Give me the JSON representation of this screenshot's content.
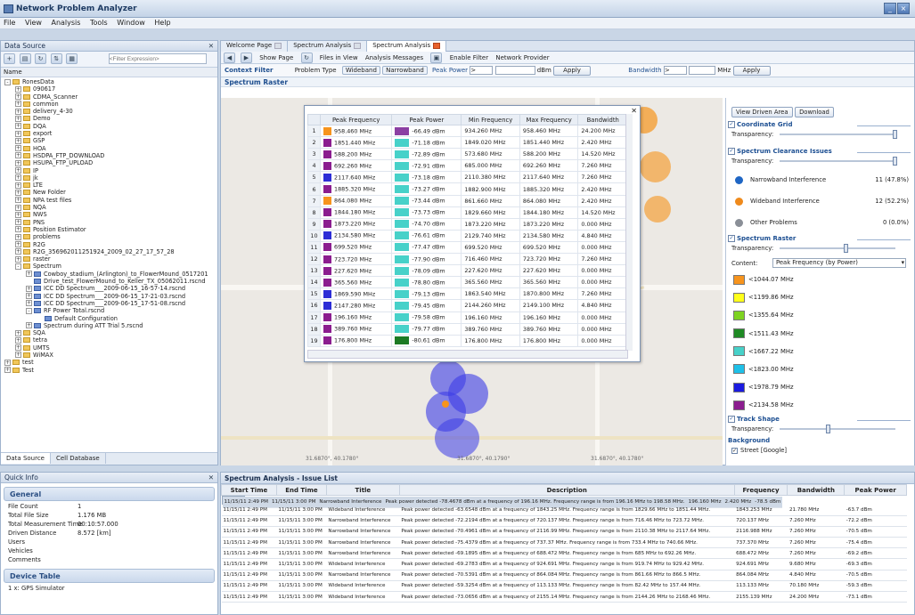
{
  "app": {
    "title": "Network Problem Analyzer"
  },
  "menu": [
    "File",
    "View",
    "Analysis",
    "Tools",
    "Window",
    "Help"
  ],
  "left_panel": {
    "title": "Data Source",
    "filter_placeholder": "<Filter Expression>",
    "tree_header": "Name",
    "tree": [
      {
        "d": 0,
        "t": "RonesData",
        "k": "f",
        "x": "-"
      },
      {
        "d": 1,
        "t": "090617",
        "k": "f",
        "x": "+"
      },
      {
        "d": 1,
        "t": "CDMA_Scanner",
        "k": "f",
        "x": "+"
      },
      {
        "d": 1,
        "t": "common",
        "k": "f",
        "x": "+"
      },
      {
        "d": 1,
        "t": "delivery_4-30",
        "k": "f",
        "x": "+"
      },
      {
        "d": 1,
        "t": "Demo",
        "k": "f",
        "x": "+"
      },
      {
        "d": 1,
        "t": "DQA",
        "k": "f",
        "x": "+"
      },
      {
        "d": 1,
        "t": "export",
        "k": "f",
        "x": "+"
      },
      {
        "d": 1,
        "t": "GSP",
        "k": "f",
        "x": "+"
      },
      {
        "d": 1,
        "t": "HOA",
        "k": "f",
        "x": "+"
      },
      {
        "d": 1,
        "t": "HSDPA_FTP_DOWNLOAD",
        "k": "f",
        "x": "+"
      },
      {
        "d": 1,
        "t": "HSUPA_FTP_UPLOAD",
        "k": "f",
        "x": "+"
      },
      {
        "d": 1,
        "t": "IP",
        "k": "f",
        "x": "+"
      },
      {
        "d": 1,
        "t": "jk",
        "k": "f",
        "x": "+"
      },
      {
        "d": 1,
        "t": "LTE",
        "k": "f",
        "x": "+"
      },
      {
        "d": 1,
        "t": "New Folder",
        "k": "f",
        "x": "+"
      },
      {
        "d": 1,
        "t": "NPA test files",
        "k": "f",
        "x": "+"
      },
      {
        "d": 1,
        "t": "NQA",
        "k": "f",
        "x": "+"
      },
      {
        "d": 1,
        "t": "NWS",
        "k": "f",
        "x": "+"
      },
      {
        "d": 1,
        "t": "PNS",
        "k": "f",
        "x": "+"
      },
      {
        "d": 1,
        "t": "Position Estimator",
        "k": "f",
        "x": "+"
      },
      {
        "d": 1,
        "t": "problems",
        "k": "f",
        "x": "+"
      },
      {
        "d": 1,
        "t": "R2G",
        "k": "f",
        "x": "+"
      },
      {
        "d": 1,
        "t": "R2G_356962011251924_2009_02_27_17_57_28",
        "k": "f",
        "x": "+"
      },
      {
        "d": 1,
        "t": "raster",
        "k": "f",
        "x": "+"
      },
      {
        "d": 1,
        "t": "Spectrum",
        "k": "f",
        "x": "-"
      },
      {
        "d": 2,
        "t": "Cowboy_stadium_(Arlington)_to_FlowerMound_0517201",
        "k": "l",
        "x": "+"
      },
      {
        "d": 2,
        "t": "Drive_test_FlowerMound_to_Keller_TX_05062011.rscnd",
        "k": "l",
        "x": ""
      },
      {
        "d": 2,
        "t": "ICC DD Spectrum___2009-06-15_16-57-14.rscnd",
        "k": "l",
        "x": "+"
      },
      {
        "d": 2,
        "t": "ICC DD Spectrum___2009-06-15_17-21-03.rscnd",
        "k": "l",
        "x": "+"
      },
      {
        "d": 2,
        "t": "ICC DD Spectrum___2009-06-15_17-51-08.rscnd",
        "k": "l",
        "x": "+"
      },
      {
        "d": 2,
        "t": "RF Power Total.rscnd",
        "k": "l",
        "x": "-"
      },
      {
        "d": 3,
        "t": "Default Configuration",
        "k": "l",
        "x": ""
      },
      {
        "d": 2,
        "t": "Spectrum during ATT Trial 5.rscnd",
        "k": "l",
        "x": "+"
      },
      {
        "d": 1,
        "t": "SQA",
        "k": "f",
        "x": "+"
      },
      {
        "d": 1,
        "t": "tetra",
        "k": "f",
        "x": "+"
      },
      {
        "d": 1,
        "t": "UMTS",
        "k": "f",
        "x": "+"
      },
      {
        "d": 1,
        "t": "WiMAX",
        "k": "f",
        "x": "+"
      },
      {
        "d": 0,
        "t": "test",
        "k": "f",
        "x": "+"
      },
      {
        "d": 0,
        "t": "Test",
        "k": "f",
        "x": "+"
      }
    ],
    "tabs": [
      "Data Source",
      "Cell Database"
    ]
  },
  "quick_info": {
    "title": "Quick Info",
    "general_title": "General",
    "props": [
      [
        "File Count",
        "1"
      ],
      [
        "Total File Size",
        "1.176 MB"
      ],
      [
        "Total Measurement Time",
        "00:10:57.000"
      ],
      [
        "Driven Distance",
        "8.572 [km]"
      ],
      [
        "Users",
        ""
      ],
      [
        "Vehicles",
        ""
      ],
      [
        "Comments",
        ""
      ]
    ],
    "device_title": "Device Table",
    "device_row": "1 x: GPS Simulator"
  },
  "doc_tabs": [
    "Welcome Page",
    "Spectrum Analysis",
    "Spectrum Analysis"
  ],
  "doc_toolbar": [
    "Show Page",
    "Files in View",
    "Analysis Messages",
    "Enable Filter",
    "Network Provider"
  ],
  "filterbar": {
    "context": "Context Filter",
    "problem_type": "Problem Type",
    "wideband": "Wideband",
    "narrowband": "Narrowband",
    "peak_power": "Peak Power",
    "op1": ">",
    "unit1": "dBm",
    "apply1": "Apply",
    "bandwidth": "Bandwidth",
    "op2": ">",
    "unit2": "MHz",
    "apply2": "Apply"
  },
  "raster_title": "Spectrum Raster",
  "map_coords": [
    "31.6870°, 40.1780°",
    "31.6870°, 40.1790°",
    "31.6870°, 40.1780°"
  ],
  "popup": {
    "columns": [
      "Peak Frequency",
      "Peak Power",
      "Min Frequency",
      "Max Frequency",
      "Bandwidth"
    ],
    "rows": [
      {
        "n": "1",
        "c1": "#f7941d",
        "pf": "958.460 MHz",
        "c2": "#8b3fa3",
        "pp": "-66.49 dBm",
        "mn": "934.260 MHz",
        "mx": "958.460 MHz",
        "bw": "24.200 MHz"
      },
      {
        "n": "2",
        "c1": "#8b1d8f",
        "pf": "1851.440 MHz",
        "c2": "#47d1c9",
        "pp": "-71.18 dBm",
        "mn": "1849.020 MHz",
        "mx": "1851.440 MHz",
        "bw": "2.420 MHz"
      },
      {
        "n": "3",
        "c1": "#8b1d8f",
        "pf": "588.200 MHz",
        "c2": "#47d1c9",
        "pp": "-72.89 dBm",
        "mn": "573.680 MHz",
        "mx": "588.200 MHz",
        "bw": "14.520 MHz"
      },
      {
        "n": "4",
        "c1": "#8b1d8f",
        "pf": "692.260 MHz",
        "c2": "#47d1c9",
        "pp": "-72.91 dBm",
        "mn": "685.000 MHz",
        "mx": "692.260 MHz",
        "bw": "7.260 MHz"
      },
      {
        "n": "5",
        "c1": "#2d2dd6",
        "pf": "2117.640 MHz",
        "c2": "#47d1c9",
        "pp": "-73.18 dBm",
        "mn": "2110.380 MHz",
        "mx": "2117.640 MHz",
        "bw": "7.260 MHz"
      },
      {
        "n": "6",
        "c1": "#8b1d8f",
        "pf": "1885.320 MHz",
        "c2": "#47d1c9",
        "pp": "-73.27 dBm",
        "mn": "1882.900 MHz",
        "mx": "1885.320 MHz",
        "bw": "2.420 MHz"
      },
      {
        "n": "7",
        "c1": "#f7941d",
        "pf": "864.080 MHz",
        "c2": "#47d1c9",
        "pp": "-73.44 dBm",
        "mn": "861.660 MHz",
        "mx": "864.080 MHz",
        "bw": "2.420 MHz"
      },
      {
        "n": "8",
        "c1": "#8b1d8f",
        "pf": "1844.180 MHz",
        "c2": "#47d1c9",
        "pp": "-73.73 dBm",
        "mn": "1829.660 MHz",
        "mx": "1844.180 MHz",
        "bw": "14.520 MHz"
      },
      {
        "n": "9",
        "c1": "#8b1d8f",
        "pf": "1873.220 MHz",
        "c2": "#47d1c9",
        "pp": "-74.70 dBm",
        "mn": "1873.220 MHz",
        "mx": "1873.220 MHz",
        "bw": "0.000 MHz"
      },
      {
        "n": "10",
        "c1": "#2d2dd6",
        "pf": "2134.580 MHz",
        "c2": "#47d1c9",
        "pp": "-76.61 dBm",
        "mn": "2129.740 MHz",
        "mx": "2134.580 MHz",
        "bw": "4.840 MHz"
      },
      {
        "n": "11",
        "c1": "#8b1d8f",
        "pf": "699.520 MHz",
        "c2": "#47d1c9",
        "pp": "-77.47 dBm",
        "mn": "699.520 MHz",
        "mx": "699.520 MHz",
        "bw": "0.000 MHz"
      },
      {
        "n": "12",
        "c1": "#8b1d8f",
        "pf": "723.720 MHz",
        "c2": "#47d1c9",
        "pp": "-77.90 dBm",
        "mn": "716.460 MHz",
        "mx": "723.720 MHz",
        "bw": "7.260 MHz"
      },
      {
        "n": "13",
        "c1": "#8b1d8f",
        "pf": "227.620 MHz",
        "c2": "#47d1c9",
        "pp": "-78.09 dBm",
        "mn": "227.620 MHz",
        "mx": "227.620 MHz",
        "bw": "0.000 MHz"
      },
      {
        "n": "14",
        "c1": "#8b1d8f",
        "pf": "365.560 MHz",
        "c2": "#47d1c9",
        "pp": "-78.80 dBm",
        "mn": "365.560 MHz",
        "mx": "365.560 MHz",
        "bw": "0.000 MHz"
      },
      {
        "n": "15",
        "c1": "#2d2dd6",
        "pf": "1869.590 MHz",
        "c2": "#47d1c9",
        "pp": "-79.13 dBm",
        "mn": "1863.540 MHz",
        "mx": "1870.800 MHz",
        "bw": "7.260 MHz"
      },
      {
        "n": "16",
        "c1": "#2d2dd6",
        "pf": "2147.280 MHz",
        "c2": "#47d1c9",
        "pp": "-79.45 dBm",
        "mn": "2144.260 MHz",
        "mx": "2149.100 MHz",
        "bw": "4.840 MHz"
      },
      {
        "n": "17",
        "c1": "#8b1d8f",
        "pf": "196.160 MHz",
        "c2": "#47d1c9",
        "pp": "-79.58 dBm",
        "mn": "196.160 MHz",
        "mx": "196.160 MHz",
        "bw": "0.000 MHz"
      },
      {
        "n": "18",
        "c1": "#8b1d8f",
        "pf": "389.760 MHz",
        "c2": "#47d1c9",
        "pp": "-79.77 dBm",
        "mn": "389.760 MHz",
        "mx": "389.760 MHz",
        "bw": "0.000 MHz"
      },
      {
        "n": "19",
        "c1": "#8b1d8f",
        "pf": "176.800 MHz",
        "c2": "#1c7a24",
        "pp": "-80.61 dBm",
        "mn": "176.800 MHz",
        "mx": "176.800 MHz",
        "bw": "0.000 MHz"
      }
    ]
  },
  "right_pane": {
    "view_driven_area": "View Driven Area",
    "download": "Download",
    "coordinate_grid": "Coordinate Grid",
    "transparency": "Transparency:",
    "clearance_title": "Spectrum Clearance Issues",
    "issues": [
      {
        "label": "Narrowband Interference",
        "value": "11 (47.8%)",
        "color": "#1f66c4"
      },
      {
        "label": "Wideband Interference",
        "value": "12 (52.2%)",
        "color": "#ef8a1c"
      },
      {
        "label": "Other Problems",
        "value": "0 (0.0%)",
        "color": "#8a8f97"
      }
    ],
    "raster_title": "Spectrum Raster",
    "content_label": "Content:",
    "content_value": "Peak Frequency (by Power)",
    "legend": [
      {
        "label": "<1044.07 MHz",
        "color": "#f7941d"
      },
      {
        "label": "<1199.86 MHz",
        "color": "#ffff1a"
      },
      {
        "label": "<1355.64 MHz",
        "color": "#7ed321"
      },
      {
        "label": "<1511.43 MHz",
        "color": "#1f8a24"
      },
      {
        "label": "<1667.22 MHz",
        "color": "#47d1c9"
      },
      {
        "label": "<1823.00 MHz",
        "color": "#1ec0e8"
      },
      {
        "label": "<1978.79 MHz",
        "color": "#1b1be0"
      },
      {
        "label": "<2134.58 MHz",
        "color": "#8b1d8f"
      }
    ],
    "track_shape": "Track Shape",
    "background": "Background",
    "street": "Street [Google]"
  },
  "issues": {
    "title": "Spectrum Analysis - Issue List",
    "columns": [
      "Start Time",
      "End Time",
      "Title",
      "Description",
      "Frequency",
      "Bandwidth",
      "Peak Power"
    ],
    "rows": [
      [
        "11/15/11 2:49 PM",
        "11/15/11 3:00 PM",
        "Narrowband Interference",
        "Peak power detected -78.4678 dBm at a frequency of 196.16 MHz. Frequency range is from 196.16 MHz to 198.58 MHz.",
        "196.160 MHz",
        "2.420 MHz",
        "-78.5 dBm"
      ],
      [
        "11/15/11 2:49 PM",
        "11/15/11 3:00 PM",
        "Wideband Interference",
        "Peak power detected -63.6548 dBm at a frequency of 1843.25 MHz. Frequency range is from 1829.66 MHz to 1851.44 MHz.",
        "1843.253 MHz",
        "21.780 MHz",
        "-63.7 dBm"
      ],
      [
        "11/15/11 2:49 PM",
        "11/15/11 3:00 PM",
        "Narrowband Interference",
        "Peak power detected -72.2194 dBm at a frequency of 720.137 MHz. Frequency range is from 716.46 MHz to 723.72 MHz.",
        "720.137 MHz",
        "7.260 MHz",
        "-72.2 dBm"
      ],
      [
        "11/15/11 2:49 PM",
        "11/15/11 3:00 PM",
        "Narrowband Interference",
        "Peak power detected -70.4961 dBm at a frequency of 2116.99 MHz. Frequency range is from 2110.38 MHz to 2117.64 MHz.",
        "2116.988 MHz",
        "7.260 MHz",
        "-70.5 dBm"
      ],
      [
        "11/15/11 2:49 PM",
        "11/15/11 3:00 PM",
        "Narrowband Interference",
        "Peak power detected -75.4379 dBm at a frequency of 737.37 MHz. Frequency range is from 733.4 MHz to 740.66 MHz.",
        "737.370 MHz",
        "7.260 MHz",
        "-75.4 dBm"
      ],
      [
        "11/15/11 2:49 PM",
        "11/15/11 3:00 PM",
        "Narrowband Interference",
        "Peak power detected -69.1895 dBm at a frequency of 688.472 MHz. Frequency range is from 685 MHz to 692.26 MHz.",
        "688.472 MHz",
        "7.260 MHz",
        "-69.2 dBm"
      ],
      [
        "11/15/11 2:49 PM",
        "11/15/11 3:00 PM",
        "Wideband Interference",
        "Peak power detected -69.2783 dBm at a frequency of 924.691 MHz. Frequency range is from 919.74 MHz to 929.42 MHz.",
        "924.691 MHz",
        "9.680 MHz",
        "-69.3 dBm"
      ],
      [
        "11/15/11 2:49 PM",
        "11/15/11 3:00 PM",
        "Narrowband Interference",
        "Peak power detected -70.5391 dBm at a frequency of 864.084 MHz. Frequency range is from 861.66 MHz to 866.5 MHz.",
        "864.084 MHz",
        "4.840 MHz",
        "-70.5 dBm"
      ],
      [
        "11/15/11 2:49 PM",
        "11/15/11 3:00 PM",
        "Wideband Interference",
        "Peak power detected -59.3254 dBm at a frequency of 113.133 MHz. Frequency range is from 82.42 MHz to 157.44 MHz.",
        "113.133 MHz",
        "70.180 MHz",
        "-59.3 dBm"
      ],
      [
        "11/15/11 2:49 PM",
        "11/15/11 3:00 PM",
        "Wideband Interference",
        "Peak power detected -73.0656 dBm at a frequency of 2155.14 MHz. Frequency range is from 2144.26 MHz to 2168.46 MHz.",
        "2155.139 MHz",
        "24.200 MHz",
        "-73.1 dBm"
      ]
    ]
  }
}
